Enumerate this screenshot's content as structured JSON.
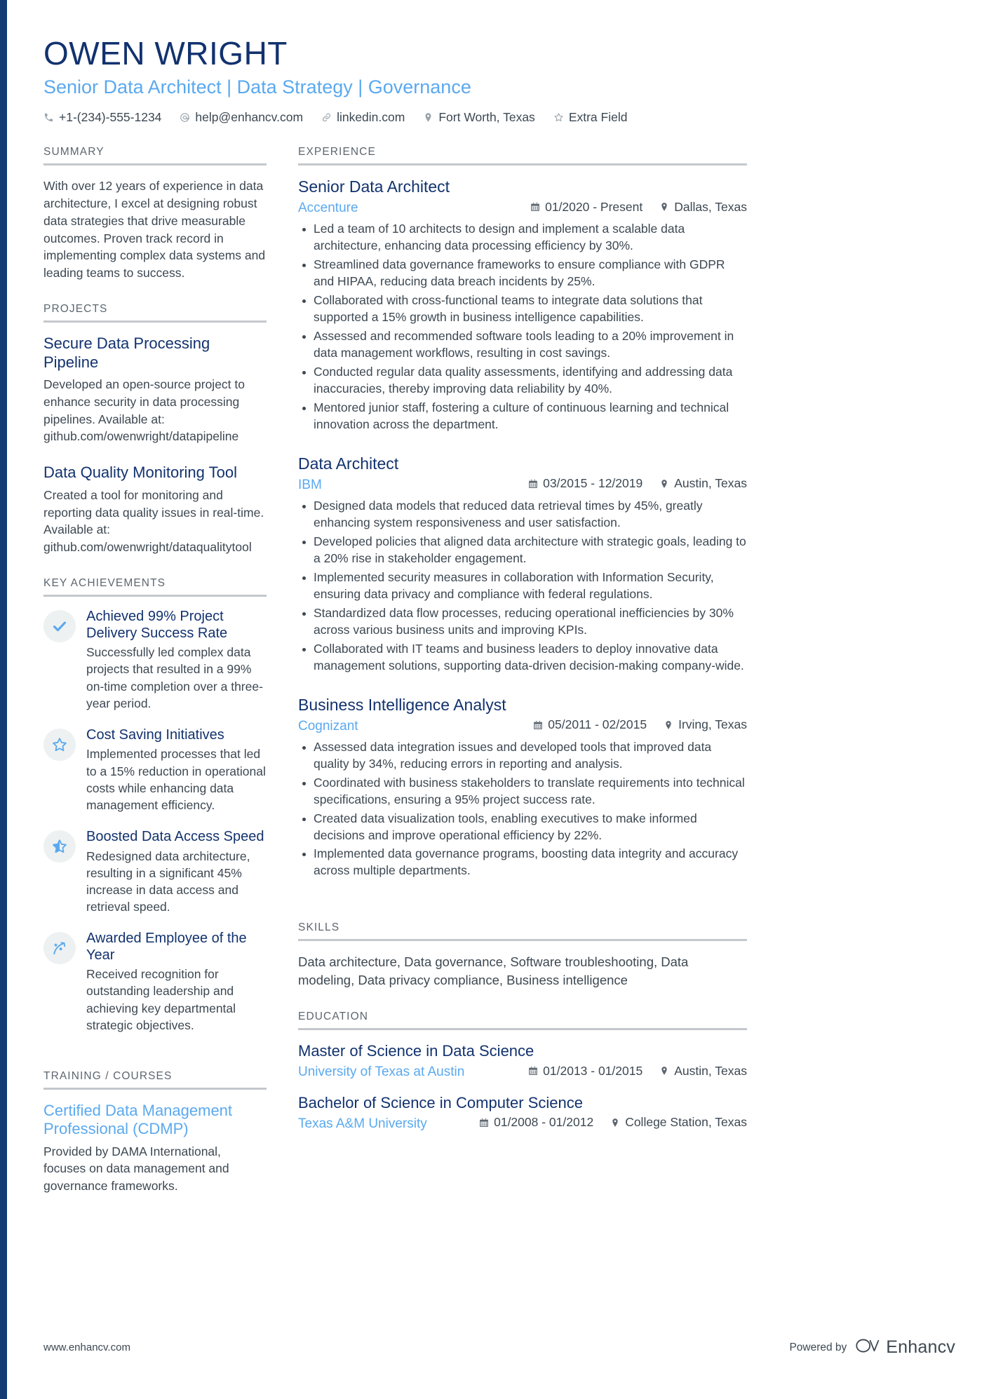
{
  "header": {
    "name": "OWEN WRIGHT",
    "headline": "Senior Data Architect | Data Strategy | Governance",
    "contacts": [
      {
        "icon": "phone-icon",
        "text": "+1-(234)-555-1234"
      },
      {
        "icon": "email-icon",
        "text": "help@enhancv.com"
      },
      {
        "icon": "link-icon",
        "text": "linkedin.com"
      },
      {
        "icon": "location-pin-icon",
        "text": "Fort Worth, Texas"
      },
      {
        "icon": "star-icon",
        "text": "Extra Field"
      }
    ]
  },
  "summary": {
    "title": "SUMMARY",
    "text": "With over 12 years of experience in data architecture, I excel at designing robust data strategies that drive measurable outcomes. Proven track record in implementing complex data systems and leading teams to success."
  },
  "projects": {
    "title": "PROJECTS",
    "items": [
      {
        "name": "Secure Data Processing Pipeline",
        "description": "Developed an open-source project to enhance security in data processing pipelines. Available at: github.com/owenwright/datapipeline"
      },
      {
        "name": "Data Quality Monitoring Tool",
        "description": "Created a tool for monitoring and reporting data quality issues in real-time. Available at: github.com/owenwright/dataqualitytool"
      }
    ]
  },
  "key_achievements": {
    "title": "KEY ACHIEVEMENTS",
    "items": [
      {
        "icon": "check-icon",
        "title": "Achieved 99% Project Delivery Success Rate",
        "description": "Successfully led complex data projects that resulted in a 99% on-time completion over a three-year period."
      },
      {
        "icon": "star-outline-icon",
        "title": "Cost Saving Initiatives",
        "description": "Implemented processes that led to a 15% reduction in operational costs while enhancing data management efficiency."
      },
      {
        "icon": "star-half-icon",
        "title": "Boosted Data Access Speed",
        "description": "Redesigned data architecture, resulting in a significant 45% increase in data access and retrieval speed."
      },
      {
        "icon": "strategy-arrow-icon",
        "title": "Awarded Employee of the Year",
        "description": "Received recognition for outstanding leadership and achieving key departmental strategic objectives."
      }
    ]
  },
  "training": {
    "title": "TRAINING / COURSES",
    "items": [
      {
        "name": "Certified Data Management Professional (CDMP)",
        "description": "Provided by DAMA International, focuses on data management and governance frameworks."
      }
    ]
  },
  "experience": {
    "title": "EXPERIENCE",
    "jobs": [
      {
        "title": "Senior Data Architect",
        "company": "Accenture",
        "date": "01/2020 - Present",
        "location": "Dallas, Texas",
        "bullets": [
          "Led a team of 10 architects to design and implement a scalable data architecture, enhancing data processing efficiency by 30%.",
          "Streamlined data governance frameworks to ensure compliance with GDPR and HIPAA, reducing data breach incidents by 25%.",
          "Collaborated with cross-functional teams to integrate data solutions that supported a 15% growth in business intelligence capabilities.",
          "Assessed and recommended software tools leading to a 20% improvement in data management workflows, resulting in cost savings.",
          "Conducted regular data quality assessments, identifying and addressing data inaccuracies, thereby improving data reliability by 40%.",
          "Mentored junior staff, fostering a culture of continuous learning and technical innovation across the department."
        ]
      },
      {
        "title": "Data Architect",
        "company": "IBM",
        "date": "03/2015 - 12/2019",
        "location": "Austin, Texas",
        "bullets": [
          "Designed data models that reduced data retrieval times by 45%, greatly enhancing system responsiveness and user satisfaction.",
          "Developed policies that aligned data architecture with strategic goals, leading to a 20% rise in stakeholder engagement.",
          "Implemented security measures in collaboration with Information Security, ensuring data privacy and compliance with federal regulations.",
          "Standardized data flow processes, reducing operational inefficiencies by 30% across various business units and improving KPIs.",
          "Collaborated with IT teams and business leaders to deploy innovative data management solutions, supporting data-driven decision-making company-wide."
        ]
      },
      {
        "title": "Business Intelligence Analyst",
        "company": "Cognizant",
        "date": "05/2011 - 02/2015",
        "location": "Irving, Texas",
        "bullets": [
          "Assessed data integration issues and developed tools that improved data quality by 34%, reducing errors in reporting and analysis.",
          "Coordinated with business stakeholders to translate requirements into technical specifications, ensuring a 95% project success rate.",
          "Created data visualization tools, enabling executives to make informed decisions and improve operational efficiency by 22%.",
          "Implemented data governance programs, boosting data integrity and accuracy across multiple departments."
        ]
      }
    ]
  },
  "skills": {
    "title": "SKILLS",
    "text": "Data architecture, Data governance, Software troubleshooting, Data modeling, Data privacy compliance, Business intelligence"
  },
  "education": {
    "title": "EDUCATION",
    "items": [
      {
        "degree": "Master of Science in Data Science",
        "school": "University of Texas at Austin",
        "date": "01/2013 - 01/2015",
        "location": "Austin, Texas"
      },
      {
        "degree": "Bachelor of Science in Computer Science",
        "school": "Texas A&M University",
        "date": "01/2008 - 01/2012",
        "location": "College Station, Texas"
      }
    ]
  },
  "footer": {
    "url": "www.enhancv.com",
    "powered_by": "Powered by",
    "brand": "Enhancv"
  },
  "colors": {
    "dark_blue": "#12326e",
    "light_blue": "#5aa9ef",
    "body_gray": "#3d4852",
    "rule_gray": "#c4c8cd"
  }
}
